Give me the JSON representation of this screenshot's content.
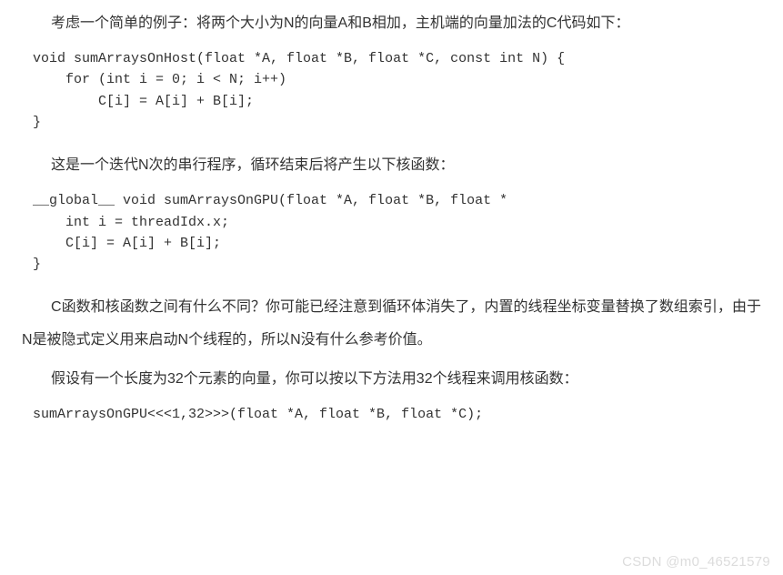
{
  "paragraphs": {
    "p1": "考虑一个简单的例子：将两个大小为N的向量A和B相加，主机端的向量加法的C代码如下：",
    "p2": "这是一个迭代N次的串行程序，循环结束后将产生以下核函数：",
    "p3": "C函数和核函数之间有什么不同？你可能已经注意到循环体消失了，内置的线程坐标变量替换了数组索引，由于N是被隐式定义用来启动N个线程的，所以N没有什么参考价值。",
    "p4": "假设有一个长度为32个元素的向量，你可以按以下方法用32个线程来调用核函数："
  },
  "code": {
    "block1": "void sumArraysOnHost(float *A, float *B, float *C, const int N) {\n    for (int i = 0; i < N; i++)\n        C[i] = A[i] + B[i];\n}",
    "block2": "__global__ void sumArraysOnGPU(float *A, float *B, float *\n    int i = threadIdx.x;\n    C[i] = A[i] + B[i];\n}",
    "block3": "sumArraysOnGPU<<<1,32>>>(float *A, float *B, float *C);"
  },
  "watermark": "CSDN @m0_46521579"
}
